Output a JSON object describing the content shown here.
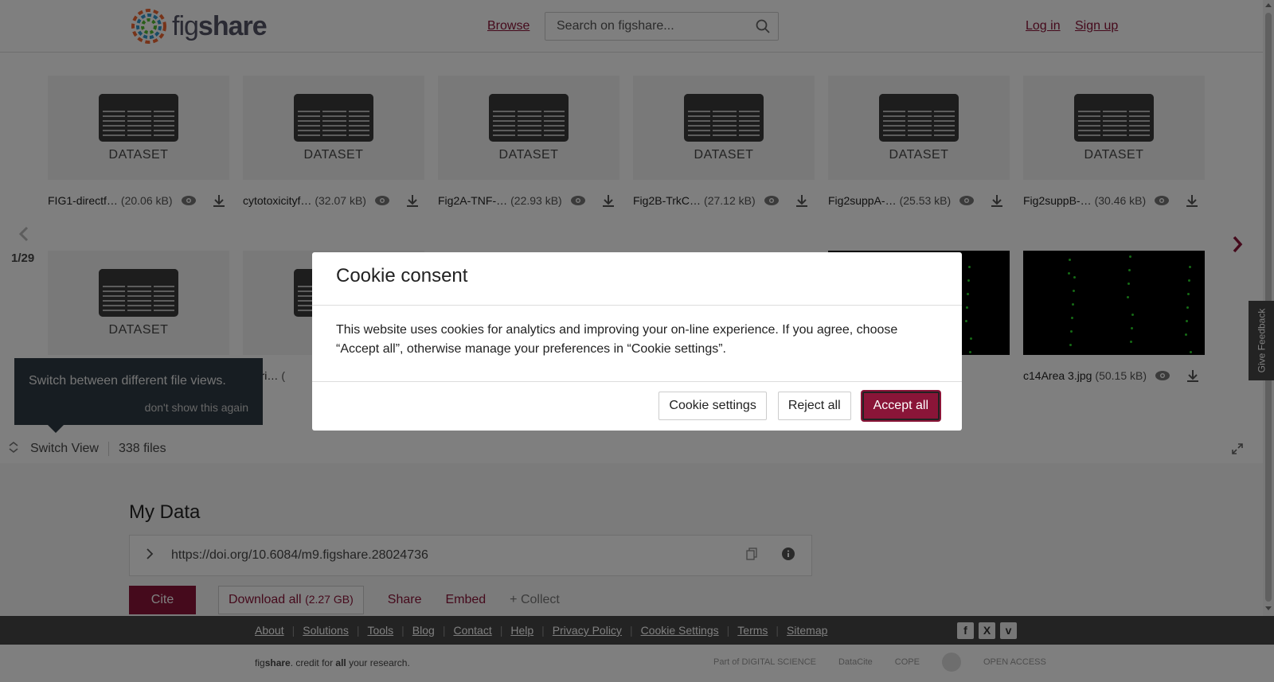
{
  "header": {
    "logo_text_fig": "fig",
    "logo_text_share": "share",
    "browse": "Browse",
    "search_placeholder": "Search on figshare...",
    "login": "Log in",
    "signup": "Sign up"
  },
  "files": [
    {
      "type_label": "DATASET",
      "name": "FIG1-directf…",
      "size": "(20.06 kB)",
      "thumb": "dataset"
    },
    {
      "type_label": "DATASET",
      "name": "cytotoxicityf…",
      "size": "(32.07 kB)",
      "thumb": "dataset"
    },
    {
      "type_label": "DATASET",
      "name": "Fig2A-TNF-…",
      "size": "(22.93 kB)",
      "thumb": "dataset"
    },
    {
      "type_label": "DATASET",
      "name": "Fig2B-TrkC…",
      "size": "(27.12 kB)",
      "thumb": "dataset"
    },
    {
      "type_label": "DATASET",
      "name": "Fig2suppA-…",
      "size": "(25.53 kB)",
      "thumb": "dataset"
    },
    {
      "type_label": "DATASET",
      "name": "Fig2suppB-…",
      "size": "(30.46 kB)",
      "thumb": "dataset"
    },
    {
      "type_label": "DATASET",
      "name": "",
      "size": "",
      "thumb": "dataset"
    },
    {
      "type_label": "D",
      "name": "xperi…",
      "size": "(",
      "thumb": "dataset"
    },
    {
      "type_label": "",
      "name": "",
      "size": "",
      "thumb": "image"
    },
    {
      "type_label": "",
      "name": "c14Area 3.jpg",
      "size": "(50.15 kB)",
      "thumb": "image"
    }
  ],
  "pager": {
    "current": "1/29"
  },
  "tooltip": {
    "text": "Switch between different file views.",
    "dismiss": "don't show this again"
  },
  "toolbar": {
    "switch_view": "Switch View",
    "file_count": "338 files"
  },
  "mydata": {
    "title": "My Data",
    "doi": "https://doi.org/10.6084/m9.figshare.28024736",
    "cite": "Cite",
    "download_all": "Download all",
    "download_size": "(2.27 GB)",
    "share": "Share",
    "embed": "Embed",
    "collect": "+ Collect"
  },
  "footer": {
    "links": [
      "About",
      "Solutions",
      "Tools",
      "Blog",
      "Contact",
      "Help",
      "Privacy Policy",
      "Cookie Settings",
      "Terms",
      "Sitemap"
    ],
    "social": [
      "f",
      "X",
      "v"
    ],
    "tagline_fig": "fig",
    "tagline_share": "share",
    "tagline_mid": ". credit for ",
    "tagline_all": "all",
    "tagline_end": " your research.",
    "partners": [
      "Part of DIGITAL SCIENCE",
      "DataCite",
      "COPE",
      "",
      "OPEN ACCESS"
    ]
  },
  "feedback": "Give Feedback",
  "cookie": {
    "title": "Cookie consent",
    "body": "This website uses cookies for analytics and improving your on-line experience. If you agree, choose “Accept all”, otherwise manage your preferences in “Cookie settings”.",
    "settings": "Cookie settings",
    "reject": "Reject all",
    "accept": "Accept all"
  },
  "colors": {
    "brand": "#8a1538",
    "overlay": "rgba(0,0,0,0.5)",
    "dark": "#464646"
  }
}
